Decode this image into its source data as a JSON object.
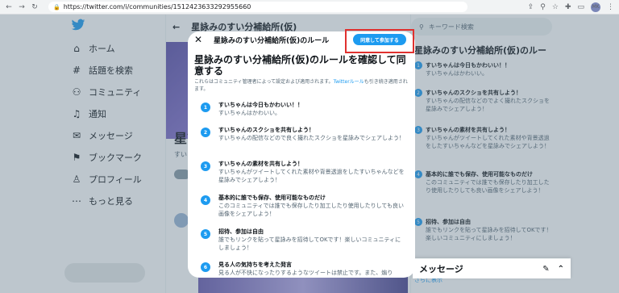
{
  "browser": {
    "url": "https://twitter.com/i/communities/1512423633292955660",
    "profile": "MK"
  },
  "sidebar": {
    "items": [
      {
        "label": "ホーム",
        "icon": "home-icon"
      },
      {
        "label": "話題を検索",
        "icon": "hashtag-icon"
      },
      {
        "label": "コミュニティ",
        "icon": "communities-icon"
      },
      {
        "label": "通知",
        "icon": "bell-icon"
      },
      {
        "label": "メッセージ",
        "icon": "mail-icon"
      },
      {
        "label": "ブックマーク",
        "icon": "bookmark-icon"
      },
      {
        "label": "プロフィール",
        "icon": "profile-icon"
      },
      {
        "label": "もっと見る",
        "icon": "more-icon"
      }
    ]
  },
  "center": {
    "header": "星詠みのすい分補給所(仮)",
    "banner_title": "星詠",
    "banner_sub": "すい"
  },
  "right": {
    "search_placeholder": "キーワード検索",
    "panel_title": "星詠みのすい分補給所(仮)のルー",
    "show_more": "さらに表示",
    "rules": [
      {
        "num": "1",
        "title": "すいちゃんは今日もかわいい！！",
        "desc": "すいちゃんはかわいい。"
      },
      {
        "num": "2",
        "title": "すいちゃんのスクショを共有しよう！",
        "desc": "すいちゃんの配信などのでよく撮れたスクショを星詠みでシェアしよう！"
      },
      {
        "num": "3",
        "title": "すいちゃんの素材を共有しよう！",
        "desc": "すいちゃんがツイートしてくれた素材や背景透過をしたすいちゃんなどを星詠みでシェアしよう！"
      },
      {
        "num": "4",
        "title": "基本的に誰でも保存、使用可能なものだけ",
        "desc": "このコミュニティでは誰でも保存したり加工したり使用したりしても良い画像をシェアしよう！"
      },
      {
        "num": "5",
        "title": "招待、参加は自由",
        "desc": "誰でもリンクを貼って星詠みを招待してOKです！楽しいコミュニティにしましょう！"
      }
    ]
  },
  "messages_bar": {
    "label": "メッセージ"
  },
  "modal": {
    "title": "星詠みのすい分補給所(仮)のルール",
    "agree_button": "同意して参加する",
    "big_title": "星詠みのすい分補給所(仮)のルールを確認して同意する",
    "intro_text": "これらはコミュニティ管理者によって設定および適用されます。",
    "intro_link": "Twitterルール",
    "intro_suffix": "も引き続き適用されます。",
    "rules": [
      {
        "num": "1",
        "title": "すいちゃんは今日もかわいい！！",
        "desc": "すいちゃんはかわいい。"
      },
      {
        "num": "2",
        "title": "すいちゃんのスクショを共有しよう！",
        "desc": "すいちゃんの配信などので良く撮れたスクショを星詠みでシェアしよう！"
      },
      {
        "num": "3",
        "title": "すいちゃんの素材を共有しよう！",
        "desc": "すいちゃんがツイートしてくれた素材や背景透過をしたすいちゃんなどを星詠みでシェアしよう！"
      },
      {
        "num": "4",
        "title": "基本的に誰でも保存、使用可能なものだけ",
        "desc": "このコミュニティでは誰でも保存したり加工したり使用したりしても良い画像をシェアしよう！"
      },
      {
        "num": "5",
        "title": "招待、参加は自由",
        "desc": "誰でもリンクを貼って星詠みを招待してOKです！楽しいコミュニティにしましょう！"
      },
      {
        "num": "6",
        "title": "見る人の気持ちを考えた発言",
        "desc": "見る人が不快になったりするようなツイートは禁止です。また、煽り"
      }
    ]
  },
  "colors": {
    "accent": "#1d9bf0",
    "highlight": "#e0312f",
    "overlay": "rgba(91,112,131,0.4)"
  }
}
